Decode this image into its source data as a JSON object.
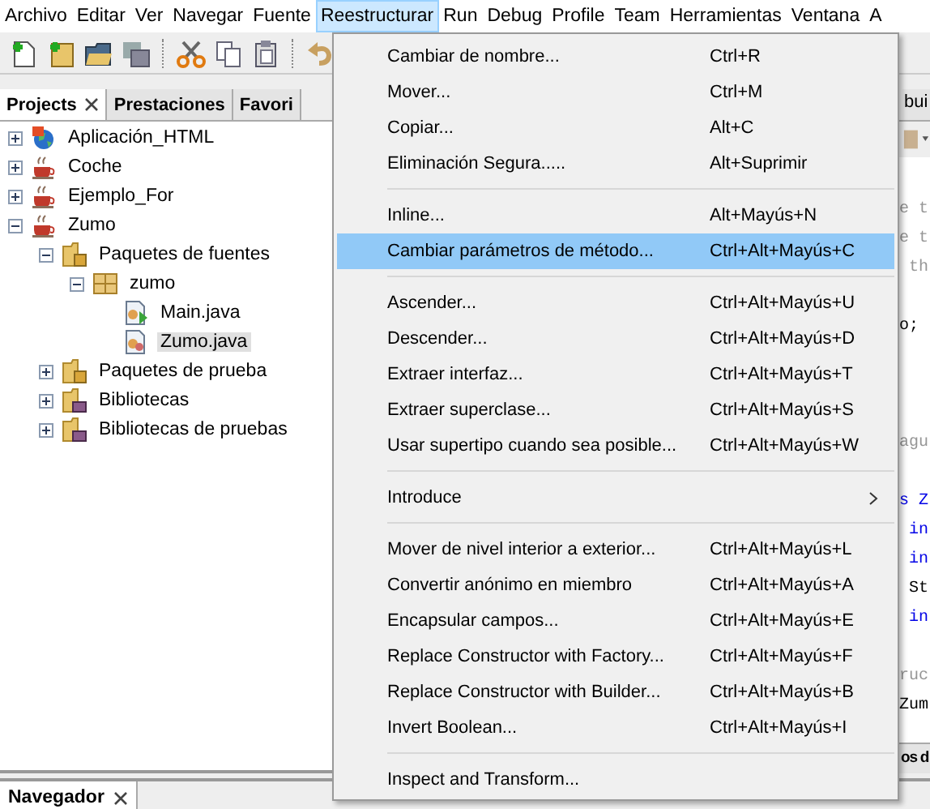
{
  "menubar": [
    {
      "label": "Archivo",
      "selected": false
    },
    {
      "label": "Editar",
      "selected": false
    },
    {
      "label": "Ver",
      "selected": false
    },
    {
      "label": "Navegar",
      "selected": false
    },
    {
      "label": "Fuente",
      "selected": false
    },
    {
      "label": "Reestructurar",
      "selected": true
    },
    {
      "label": "Run",
      "selected": false
    },
    {
      "label": "Debug",
      "selected": false
    },
    {
      "label": "Profile",
      "selected": false
    },
    {
      "label": "Team",
      "selected": false
    },
    {
      "label": "Herramientas",
      "selected": false
    },
    {
      "label": "Ventana",
      "selected": false
    },
    {
      "label": "A",
      "selected": false
    }
  ],
  "project_panel": {
    "tabs": [
      {
        "label": "Projects",
        "selected": true,
        "closable": true
      },
      {
        "label": "Prestaciones",
        "selected": false,
        "closable": false
      },
      {
        "label": "Favori",
        "selected": false,
        "closable": false
      }
    ],
    "tree": [
      {
        "label": "Aplicación_HTML",
        "kind": "web-project",
        "expanded": false,
        "selected": false
      },
      {
        "label": "Coche",
        "kind": "java-project",
        "expanded": false,
        "selected": false
      },
      {
        "label": "Ejemplo_For",
        "kind": "java-project",
        "expanded": false,
        "selected": false
      },
      {
        "label": "Zumo",
        "kind": "java-project",
        "expanded": true,
        "selected": false,
        "children": [
          {
            "label": "Paquetes de fuentes",
            "kind": "source-folder",
            "expanded": true,
            "selected": false,
            "children": [
              {
                "label": "zumo",
                "kind": "package",
                "expanded": true,
                "selected": false,
                "children": [
                  {
                    "label": "Main.java",
                    "kind": "main-class",
                    "selected": false
                  },
                  {
                    "label": "Zumo.java",
                    "kind": "class",
                    "selected": true
                  }
                ]
              }
            ]
          },
          {
            "label": "Paquetes de prueba",
            "kind": "source-folder",
            "expanded": false,
            "selected": false
          },
          {
            "label": "Bibliotecas",
            "kind": "library",
            "expanded": false,
            "selected": false
          },
          {
            "label": "Bibliotecas de pruebas",
            "kind": "library",
            "expanded": false,
            "selected": false
          }
        ]
      }
    ]
  },
  "editor": {
    "tab": "bui",
    "lines": [
      {
        "kind": "comment",
        "text": "e t"
      },
      {
        "kind": "comment",
        "text": "e t"
      },
      {
        "kind": "comment",
        "text": " th"
      },
      {
        "kind": "blank"
      },
      {
        "kind": "code",
        "text": "o;"
      },
      {
        "kind": "blank"
      },
      {
        "kind": "blank"
      },
      {
        "kind": "blank"
      },
      {
        "kind": "comment",
        "text": "agu"
      },
      {
        "kind": "blank"
      },
      {
        "kind": "keyword",
        "text": "s Z"
      },
      {
        "kind": "keyword",
        "text": " in"
      },
      {
        "kind": "keyword",
        "text": " in"
      },
      {
        "kind": "code",
        "text": " St"
      },
      {
        "kind": "keyword",
        "text": " in"
      },
      {
        "kind": "blank"
      },
      {
        "kind": "comment",
        "text": "ruc"
      },
      {
        "kind": "code",
        "text": "Zum"
      }
    ],
    "output_panel": {
      "title": "os d"
    }
  },
  "navigator_panel": {
    "tab": "Navegador",
    "closable": true
  },
  "menu": {
    "groups": [
      [
        {
          "label": "Cambiar de nombre...",
          "shortcut": "Ctrl+R",
          "selected": false
        },
        {
          "label": "Mover...",
          "shortcut": "Ctrl+M",
          "selected": false
        },
        {
          "label": "Copiar...",
          "shortcut": "Alt+C",
          "selected": false
        },
        {
          "label": "Eliminación Segura.....",
          "shortcut": "Alt+Suprimir",
          "selected": false
        }
      ],
      [
        {
          "label": "Inline...",
          "shortcut": "Alt+Mayús+N",
          "selected": false
        },
        {
          "label": "Cambiar parámetros de método...",
          "shortcut": "Ctrl+Alt+Mayús+C",
          "selected": true
        }
      ],
      [
        {
          "label": "Ascender...",
          "shortcut": "Ctrl+Alt+Mayús+U",
          "selected": false
        },
        {
          "label": "Descender...",
          "shortcut": "Ctrl+Alt+Mayús+D",
          "selected": false
        },
        {
          "label": "Extraer interfaz...",
          "shortcut": "Ctrl+Alt+Mayús+T",
          "selected": false
        },
        {
          "label": "Extraer superclase...",
          "shortcut": "Ctrl+Alt+Mayús+S",
          "selected": false
        },
        {
          "label": "Usar supertipo cuando sea posible...",
          "shortcut": "Ctrl+Alt+Mayús+W",
          "selected": false
        }
      ],
      [
        {
          "label": "Introduce",
          "submenu": true,
          "selected": false
        }
      ],
      [
        {
          "label": "Mover de nivel interior a exterior...",
          "shortcut": "Ctrl+Alt+Mayús+L",
          "selected": false
        },
        {
          "label": "Convertir anónimo en miembro",
          "shortcut": "Ctrl+Alt+Mayús+A",
          "selected": false
        },
        {
          "label": "Encapsular campos...",
          "shortcut": "Ctrl+Alt+Mayús+E",
          "selected": false
        },
        {
          "label": "Replace Constructor with Factory...",
          "shortcut": "Ctrl+Alt+Mayús+F",
          "selected": false
        },
        {
          "label": "Replace Constructor with Builder...",
          "shortcut": "Ctrl+Alt+Mayús+B",
          "selected": false
        },
        {
          "label": "Invert Boolean...",
          "shortcut": "Ctrl+Alt+Mayús+I",
          "selected": false
        }
      ],
      [
        {
          "label": "Inspect and Transform...",
          "selected": false
        }
      ]
    ]
  }
}
